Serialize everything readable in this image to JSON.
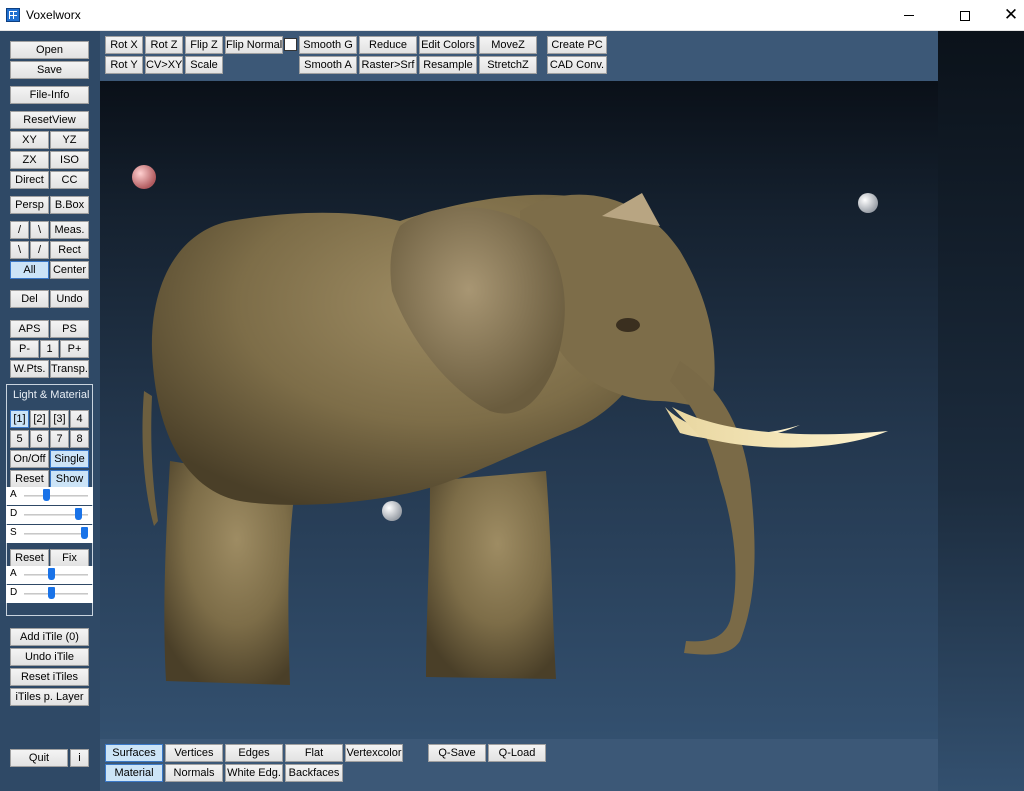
{
  "window": {
    "title": "Voxelworx",
    "icon": "voxelworx-app-icon"
  },
  "left": {
    "open": "Open",
    "save": "Save",
    "file_info": "File-Info",
    "reset_view": "ResetView",
    "xy": "XY",
    "yz": "YZ",
    "zx": "ZX",
    "iso": "ISO",
    "direct": "Direct",
    "cc": "CC",
    "persp": "Persp",
    "bbox": "B.Box",
    "slash": "/",
    "backslash": "\\",
    "meas": "Meas.",
    "backslash2": "\\",
    "slash2": "/",
    "rect": "Rect",
    "all": "All",
    "center": "Center",
    "del": "Del",
    "undo": "Undo",
    "aps": "APS",
    "ps": "PS",
    "p_minus": "P-",
    "one": "1",
    "p_plus": "P+",
    "wpts": "W.Pts.",
    "transp": "Transp.",
    "light_material": {
      "title": "Light & Material",
      "lights": [
        "[1]",
        "[2]",
        "[3]",
        "4",
        "5",
        "6",
        "7",
        "8"
      ],
      "on_off": "On/Off",
      "single": "Single",
      "reset": "Reset",
      "show": "Show",
      "light_sliders": [
        {
          "label": "A",
          "value": 0.35
        },
        {
          "label": "D",
          "value": 0.85
        },
        {
          "label": "S",
          "value": 0.93
        }
      ],
      "reset2": "Reset",
      "fix": "Fix",
      "material_sliders": [
        {
          "label": "A",
          "value": 0.42
        },
        {
          "label": "D",
          "value": 0.42
        }
      ]
    },
    "add_itile": "Add iTile (0)",
    "undo_itile": "Undo iTile",
    "reset_itiles": "Reset iTiles",
    "itiles_layer": "iTiles p. Layer",
    "quit": "Quit",
    "info": "i"
  },
  "top": {
    "rot_x": "Rot X",
    "rot_z": "Rot Z",
    "flip_z": "Flip Z",
    "flip_normals": "Flip Normals",
    "rot_y": "Rot Y",
    "cv_xy": "CV>XY",
    "scale": "Scale",
    "smooth_g": "Smooth G",
    "reduce": "Reduce",
    "edit_colors": "Edit Colors",
    "move_z": "MoveZ",
    "smooth_a": "Smooth A",
    "raster_srf": "Raster>Srf",
    "resample": "Resample",
    "stretch_z": "StretchZ",
    "create_pc": "Create PC",
    "cad_conv": "CAD Conv."
  },
  "bottom": {
    "surfaces": "Surfaces",
    "vertices": "Vertices",
    "edges": "Edges",
    "flat": "Flat",
    "vertexcolor": "Vertexcolor",
    "material": "Material",
    "normals": "Normals",
    "white_edg": "White Edg.",
    "backfaces": "Backfaces",
    "q_save": "Q-Save",
    "q_load": "Q-Load"
  },
  "viewport": {
    "model": "elephant-3d-model"
  },
  "colors": {
    "panel": "#3c5877",
    "accent_active": "#cce4f7",
    "slider_thumb": "#1a73e8"
  }
}
